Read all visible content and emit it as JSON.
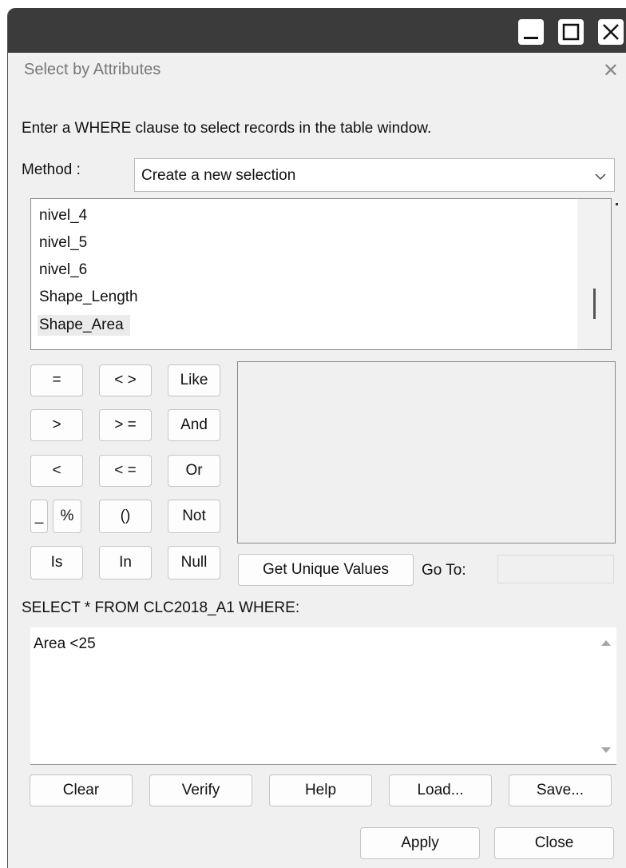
{
  "window": {
    "title": "Select by Attributes",
    "controls": [
      "minimize-icon",
      "maximize-icon",
      "close-icon"
    ]
  },
  "instruction": "Enter a WHERE clause to select records in the table window.",
  "method": {
    "label": "Method :",
    "value": "Create a new selection"
  },
  "fields": [
    "nivel_4",
    "nivel_5",
    "nivel_6",
    "Shape_Length",
    "Shape_Area"
  ],
  "selected_field": "Shape_Area",
  "operators": {
    "eq": "=",
    "ne": "< >",
    "like": "Like",
    "gt": "&gt;",
    "ge": "&gt; =",
    "and": "And",
    "lt": "&lt;",
    "le": "&lt; =",
    "or": "Or",
    "underscore": "_",
    "percent": "%",
    "parens": "()",
    "not": "Not",
    "is": "Is",
    "in": "In",
    "null": "Null"
  },
  "unique_values_button": "Get Unique Values",
  "goto_label": "Go To:",
  "goto_value": "",
  "query_prefix": "SELECT * FROM CLC2018_A1 WHERE:",
  "expression": "Area <25",
  "buttons": {
    "clear": "Clear",
    "verify": "Verify",
    "help": "Help",
    "load": "Load...",
    "save": "Save...",
    "apply": "Apply",
    "close": "Close"
  }
}
